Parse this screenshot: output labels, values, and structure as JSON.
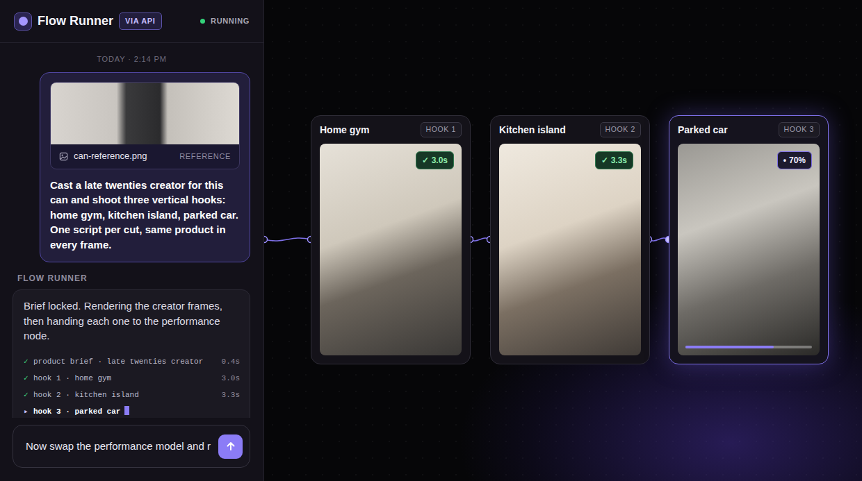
{
  "header": {
    "title": "Flow Runner",
    "badge": "VIA API",
    "status": "RUNNING"
  },
  "timestamp": "TODAY · 2:14 PM",
  "user_message": {
    "attachment": {
      "filename": "can-reference.png",
      "tag": "REFERENCE"
    },
    "text": "Cast a late twenties creator for this can and shoot three vertical hooks: home gym, kitchen island, parked car. One script per cut, same product in every frame."
  },
  "assistant": {
    "label": "FLOW RUNNER",
    "text": "Brief locked. Rendering the creator frames, then handing each one to the performance node.",
    "log": [
      {
        "icon": "✓",
        "text": "product brief · late twenties creator",
        "time": "0.4s",
        "done": true
      },
      {
        "icon": "✓",
        "text": "hook 1 · home gym",
        "time": "3.0s",
        "done": true
      },
      {
        "icon": "✓",
        "text": "hook 2 · kitchen island",
        "time": "3.3s",
        "done": true
      },
      {
        "icon": "▸",
        "text": "hook 3 · parked car",
        "done": false
      }
    ]
  },
  "composer": {
    "value": "Now swap the performance model and r"
  },
  "cards": [
    {
      "title": "Home gym",
      "hook": "HOOK 1",
      "icon": "✓",
      "status": "3.0s",
      "done": true,
      "selected": false
    },
    {
      "title": "Kitchen island",
      "hook": "HOOK 2",
      "icon": "✓",
      "status": "3.3s",
      "done": true,
      "selected": false
    },
    {
      "title": "Parked car",
      "hook": "HOOK 3",
      "icon": "•",
      "status": "70%",
      "done": false,
      "level": 0.7,
      "selected": true
    }
  ]
}
